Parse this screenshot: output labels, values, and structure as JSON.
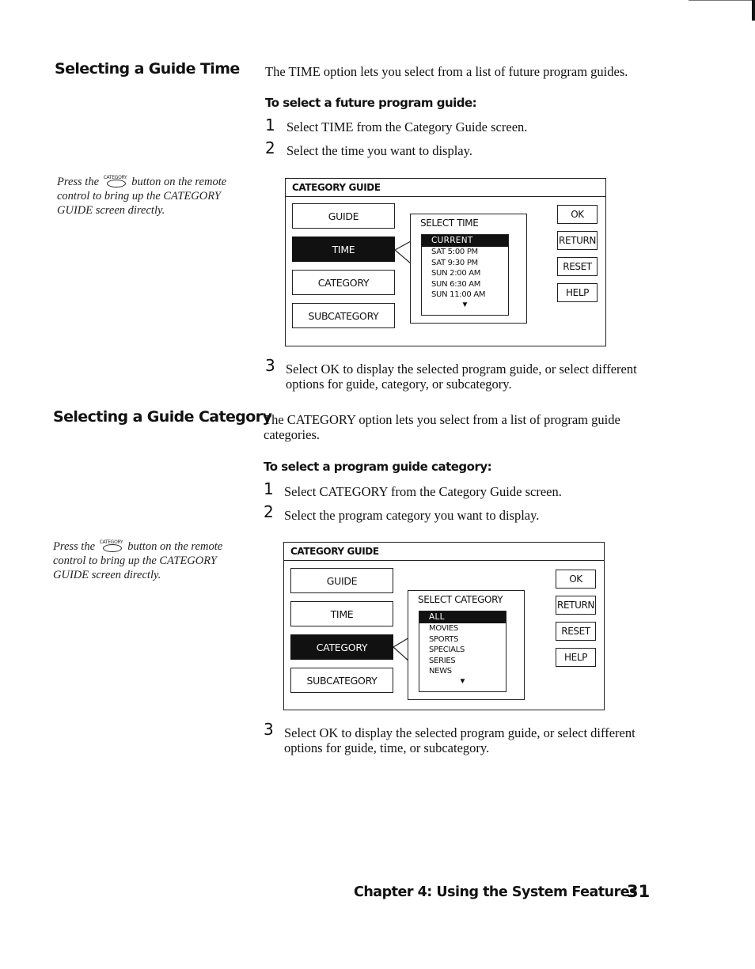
{
  "sections": {
    "time": {
      "heading": "Selecting a Guide Time",
      "intro": "The TIME option lets you select from a list of future program guides.",
      "procedure_heading": "To select a future program guide:",
      "steps": [
        {
          "num": "1",
          "text": "Select TIME from the Category Guide screen."
        },
        {
          "num": "2",
          "text": "Select the time you want to display."
        },
        {
          "num": "3",
          "text": "Select OK to display the selected program guide, or select different options for guide, category, or subcategory."
        }
      ],
      "margin_note": {
        "before": "Press the",
        "button_label": "CATEGORY",
        "after": "button on the remote control to bring up the CATEGORY GUIDE screen directly."
      },
      "screen": {
        "title": "CATEGORY GUIDE",
        "menu": [
          "GUIDE",
          "TIME",
          "CATEGORY",
          "SUBCATEGORY"
        ],
        "selected_menu": "TIME",
        "popup_title": "SELECT TIME",
        "list_selected": "CURRENT",
        "list_items": [
          "SAT 5:00 PM",
          "SAT 9:30 PM",
          "SUN 2:00 AM",
          "SUN 6:30 AM",
          "SUN 11:00 AM"
        ],
        "scroll_icon": "▼",
        "side_buttons": [
          "OK",
          "RETURN",
          "RESET",
          "HELP"
        ]
      }
    },
    "category": {
      "heading": "Selecting a Guide Category",
      "intro": "The CATEGORY option lets you select from a list of program guide categories.",
      "procedure_heading": "To select a program guide category:",
      "steps": [
        {
          "num": "1",
          "text": "Select CATEGORY from the Category Guide screen."
        },
        {
          "num": "2",
          "text": "Select the program category you want to display."
        },
        {
          "num": "3",
          "text": "Select OK to display the selected program guide, or select different options for guide, time, or subcategory."
        }
      ],
      "margin_note": {
        "before": "Press the",
        "button_label": "CATEGORY",
        "after": "button on the remote control to bring up the CATEGORY GUIDE screen directly."
      },
      "screen": {
        "title": "CATEGORY GUIDE",
        "menu": [
          "GUIDE",
          "TIME",
          "CATEGORY",
          "SUBCATEGORY"
        ],
        "selected_menu": "CATEGORY",
        "popup_title": "SELECT CATEGORY",
        "list_selected": "ALL",
        "list_items": [
          "MOVIES",
          "SPORTS",
          "SPECIALS",
          "SERIES",
          "NEWS"
        ],
        "scroll_icon": "▼",
        "side_buttons": [
          "OK",
          "RETURN",
          "RESET",
          "HELP"
        ]
      }
    }
  },
  "footer": {
    "chapter": "Chapter 4: Using the System Features",
    "page_number": "31"
  }
}
